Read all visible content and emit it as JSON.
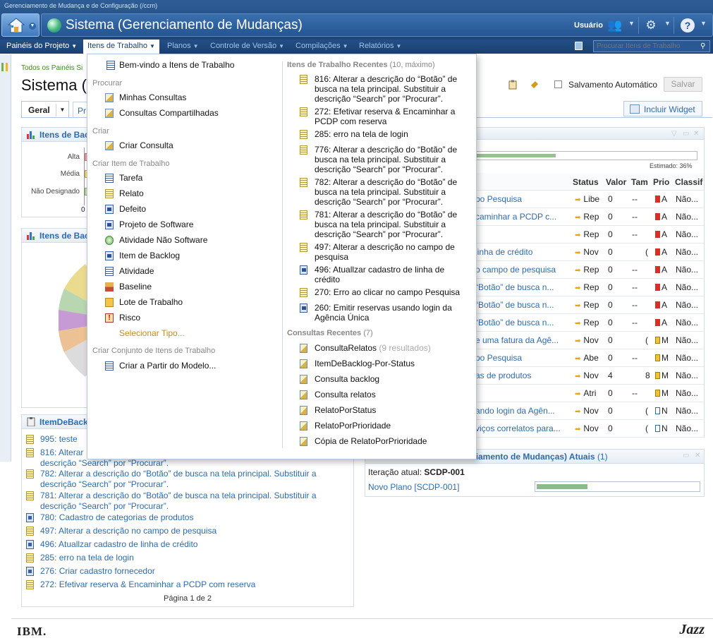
{
  "app_title": "Gerenciamento de Mudança e de Configuração (/ccm)",
  "project": {
    "title": "Sistema (Gerenciamento de Mudanças)",
    "user_label": "Usuário"
  },
  "nav": [
    {
      "label": "Painéis do Projeto",
      "icon": "chevron-down-icon"
    },
    {
      "label": "Itens de Trabalho",
      "icon": "chevron-down-icon"
    },
    {
      "label": "Planos",
      "icon": "chevron-down-icon"
    },
    {
      "label": "Controle de Versão",
      "icon": "chevron-down-icon"
    },
    {
      "label": "Compilações",
      "icon": "chevron-down-icon"
    },
    {
      "label": "Relatórios",
      "icon": "chevron-down-icon"
    }
  ],
  "search": {
    "placeholder": "Procurar Itens de Trabalho"
  },
  "breadcrumb": "Todos os Painéis Si",
  "page_title": "Sistema (",
  "toolbar": {
    "autosave_label": "Salvamento Automático",
    "save_label": "Salvar",
    "include_widget": "Incluir Widget"
  },
  "tabs": [
    {
      "label": "Geral"
    },
    {
      "label": "Pr"
    }
  ],
  "widgets": {
    "backlog_chart1": {
      "title": "Itens de Back",
      "labels": [
        "Alta",
        "Média",
        "Não Designado"
      ],
      "axis_zero": "0"
    },
    "backlog_chart2": {
      "title": "Itens de Bac"
    },
    "backlog_list": {
      "title": "ItemDeBackl",
      "items": [
        {
          "text": "995: teste"
        },
        {
          "text": "816: Alterar"
        },
        {
          "text": "descrição “Search” por “Procurar”."
        },
        {
          "text": "782: Alterar a descrição do “Botão” de busca na tela principal. Substituir a"
        },
        {
          "text": "descrição “Search” por “Procurar”."
        },
        {
          "text": "781: Alterar a descrição do “Botão” de busca na tela principal. Substituir a"
        },
        {
          "text": "descrição “Search” por “Procurar”."
        },
        {
          "text": "780: Cadastro de categorias de produtos"
        },
        {
          "text": "497: Alterar a descrição no campo de pesquisa"
        },
        {
          "text": "496: Atuallzar cadastro de linha de crédito"
        },
        {
          "text": "285: erro na tela de login"
        },
        {
          "text": "276: Criar cadastro fornecedor"
        },
        {
          "text": "272: Efetivar reserva & Encaminhar a PCDP com reserva"
        }
      ],
      "page_info": "Página 1 de 2"
    },
    "work_table": {
      "progress_label": "Estimado: 36%",
      "progress_value": 0.36,
      "columns": [
        "Status",
        "Valor",
        "Tam",
        "Prio",
        "Classif"
      ],
      "rows": [
        {
          "summary": "po Pesquisa",
          "status": "Libe",
          "valor": "0",
          "tam": "--",
          "tam2": "",
          "prio": "A",
          "prio_color": "red",
          "classif": "Não..."
        },
        {
          "summary": "caminhar a PCDP c...",
          "status": "Rep",
          "valor": "0",
          "tam": "--",
          "tam2": "",
          "prio": "A",
          "prio_color": "red",
          "classif": "Não..."
        },
        {
          "summary": "",
          "status": "Rep",
          "valor": "0",
          "tam": "--",
          "tam2": "",
          "prio": "A",
          "prio_color": "red",
          "classif": "Não..."
        },
        {
          "summary": "linha de crédito",
          "status": "Nov",
          "valor": "0",
          "tam": "",
          "tam2": "(",
          "prio": "A",
          "prio_color": "red",
          "classif": "Não..."
        },
        {
          "summary": "o campo de pesquisa",
          "status": "Rep",
          "valor": "0",
          "tam": "--",
          "tam2": "",
          "prio": "A",
          "prio_color": "red",
          "classif": "Não..."
        },
        {
          "summary": "“Botão” de busca n...",
          "status": "Rep",
          "valor": "0",
          "tam": "--",
          "tam2": "",
          "prio": "A",
          "prio_color": "red",
          "classif": "Não..."
        },
        {
          "summary": "“Botão” de busca n...",
          "status": "Rep",
          "valor": "0",
          "tam": "--",
          "tam2": "",
          "prio": "A",
          "prio_color": "red",
          "classif": "Não..."
        },
        {
          "summary": "“Botão” de busca n...",
          "status": "Rep",
          "valor": "0",
          "tam": "--",
          "tam2": "",
          "prio": "A",
          "prio_color": "red",
          "classif": "Não..."
        },
        {
          "summary": "e uma fatura da Agê...",
          "status": "Nov",
          "valor": "0",
          "tam": "",
          "tam2": "(",
          "prio": "M",
          "prio_color": "yellow",
          "classif": "Não..."
        },
        {
          "summary": "po Pesquisa",
          "status": "Abe",
          "valor": "0",
          "tam": "--",
          "tam2": "",
          "prio": "M",
          "prio_color": "yellow",
          "classif": "Não..."
        },
        {
          "summary": "as de produtos",
          "status": "Nov",
          "valor": "4",
          "tam": "",
          "tam2": "8",
          "prio": "M",
          "prio_color": "yellow",
          "classif": "Não..."
        },
        {
          "summary": "",
          "status": "Atri",
          "valor": "0",
          "tam": "--",
          "tam2": "",
          "prio": "M",
          "prio_color": "yellow",
          "classif": "Não..."
        },
        {
          "summary": "ando login da Agên...",
          "status": "Nov",
          "valor": "0",
          "tam": "",
          "tam2": "(",
          "prio": "N",
          "prio_color": "blue",
          "classif": "Não..."
        },
        {
          "summary": "viços correlatos para...",
          "status": "Nov",
          "valor": "0",
          "tam": "",
          "tam2": "(",
          "prio": "N",
          "prio_color": "blue",
          "classif": "Não..."
        }
      ]
    },
    "iteration": {
      "title": "ciamento de Mudanças) Atuais",
      "count": "(1)",
      "label_prefix": "Iteração atual:",
      "label_value": "SCDP-001",
      "plan_link": "Novo Plano [SCDP-001]",
      "progress_value": 0.31
    }
  },
  "dropdown": {
    "welcome": "Bem-vindo a Itens de Trabalho",
    "search_section": "Procurar",
    "my_queries": "Minhas Consultas",
    "shared_queries": "Consultas Compartilhadas",
    "create_section": "Criar",
    "create_query": "Criar Consulta",
    "create_item_section": "Criar Item de Trabalho",
    "types": [
      "Tarefa",
      "Relato",
      "Defeito",
      "Projeto de Software",
      "Atividade Não Software",
      "Item de Backlog",
      "Atividade",
      "Baseline",
      "Lote de Trabalho",
      "Risco"
    ],
    "select_type": "Selecionar Tipo...",
    "set_section": "Criar Conjunto de Itens de Trabalho",
    "from_template": "Criar a Partir do Modelo...",
    "recent_section": "Itens de Trabalho Recentes",
    "recent_count": "(10, máximo)",
    "recent_items": [
      {
        "text": "816: Alterar a descrição do “Botão” de busca na tela principal. Substituir a descrição “Search” por “Procurar”.",
        "icon": "note-icon"
      },
      {
        "text": "272: Efetivar reserva & Encaminhar a PCDP com reserva",
        "icon": "note-icon"
      },
      {
        "text": "285: erro na tela de login",
        "icon": "note-icon"
      },
      {
        "text": "776: Alterar a descrição do “Botão” de busca na tela principal. Substituir a descrição “Search” por “Procurar”.",
        "icon": "note-icon"
      },
      {
        "text": "782: Alterar a descrição do “Botão” de busca na tela principal. Substituir a descrição “Search” por “Procurar”.",
        "icon": "note-icon"
      },
      {
        "text": "781: Alterar a descrição do “Botão” de busca na tela principal. Substituir a descrição “Search” por “Procurar”.",
        "icon": "note-icon"
      },
      {
        "text": "497: Alterar a descrição no campo de pesquisa",
        "icon": "note-icon"
      },
      {
        "text": "496: Atuallzar cadastro de linha de crédito",
        "icon": "backlog-icon"
      },
      {
        "text": "270: Erro ao clicar no campo Pesquisa",
        "icon": "note-icon"
      },
      {
        "text": "260: Emitir reservas usando login da Agência Única",
        "icon": "backlog-icon"
      }
    ],
    "recent_queries_section": "Consultas Recentes",
    "recent_queries_count": "(7)",
    "recent_queries": [
      {
        "text": "ConsultaRelatos",
        "extra": "(9 resultados)"
      },
      {
        "text": "ItemDeBacklog-Por-Status",
        "extra": ""
      },
      {
        "text": "Consulta backlog",
        "extra": ""
      },
      {
        "text": "Consulta relatos",
        "extra": ""
      },
      {
        "text": "RelatoPorStatus",
        "extra": ""
      },
      {
        "text": "RelatoPorPrioridade",
        "extra": ""
      },
      {
        "text": "Cópia de RelatoPorPrioridade",
        "extra": ""
      }
    ]
  },
  "footer": {
    "left": "IBM.",
    "right": "Jazz"
  }
}
